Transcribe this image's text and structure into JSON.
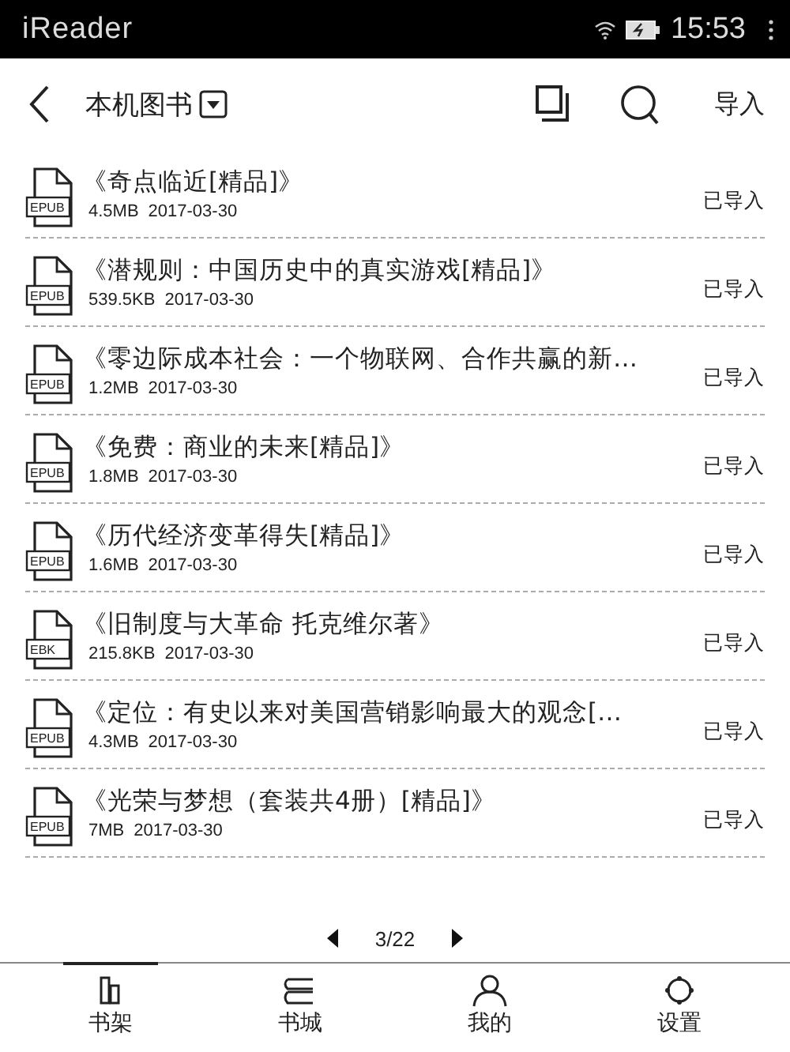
{
  "status_bar": {
    "app_name": "iReader",
    "time": "15:53"
  },
  "toolbar": {
    "title": "本机图书",
    "import_label": "导入"
  },
  "books": [
    {
      "format": "EPUB",
      "title": "《奇点临近[精品]》",
      "size": "4.5MB",
      "date": "2017-03-30",
      "status": "已导入"
    },
    {
      "format": "EPUB",
      "title": "《潜规则：中国历史中的真实游戏[精品]》",
      "size": "539.5KB",
      "date": "2017-03-30",
      "status": "已导入"
    },
    {
      "format": "EPUB",
      "title": "《零边际成本社会：一个物联网、合作共赢的新…",
      "size": "1.2MB",
      "date": "2017-03-30",
      "status": "已导入"
    },
    {
      "format": "EPUB",
      "title": "《免费：商业的未来[精品]》",
      "size": "1.8MB",
      "date": "2017-03-30",
      "status": "已导入"
    },
    {
      "format": "EPUB",
      "title": "《历代经济变革得失[精品]》",
      "size": "1.6MB",
      "date": "2017-03-30",
      "status": "已导入"
    },
    {
      "format": "EBK",
      "title": "《旧制度与大革命 托克维尔著》",
      "size": "215.8KB",
      "date": "2017-03-30",
      "status": "已导入"
    },
    {
      "format": "EPUB",
      "title": "《定位：有史以来对美国营销影响最大的观念[…",
      "size": "4.3MB",
      "date": "2017-03-30",
      "status": "已导入"
    },
    {
      "format": "EPUB",
      "title": "《光荣与梦想（套装共4册）[精品]》",
      "size": "7MB",
      "date": "2017-03-30",
      "status": "已导入"
    }
  ],
  "pager": {
    "page": "3/22"
  },
  "nav": [
    {
      "kind": "shelf",
      "label": "书架",
      "selected": true
    },
    {
      "kind": "store",
      "label": "书城",
      "selected": false
    },
    {
      "kind": "me",
      "label": "我的",
      "selected": false
    },
    {
      "kind": "settings",
      "label": "设置",
      "selected": false
    }
  ]
}
